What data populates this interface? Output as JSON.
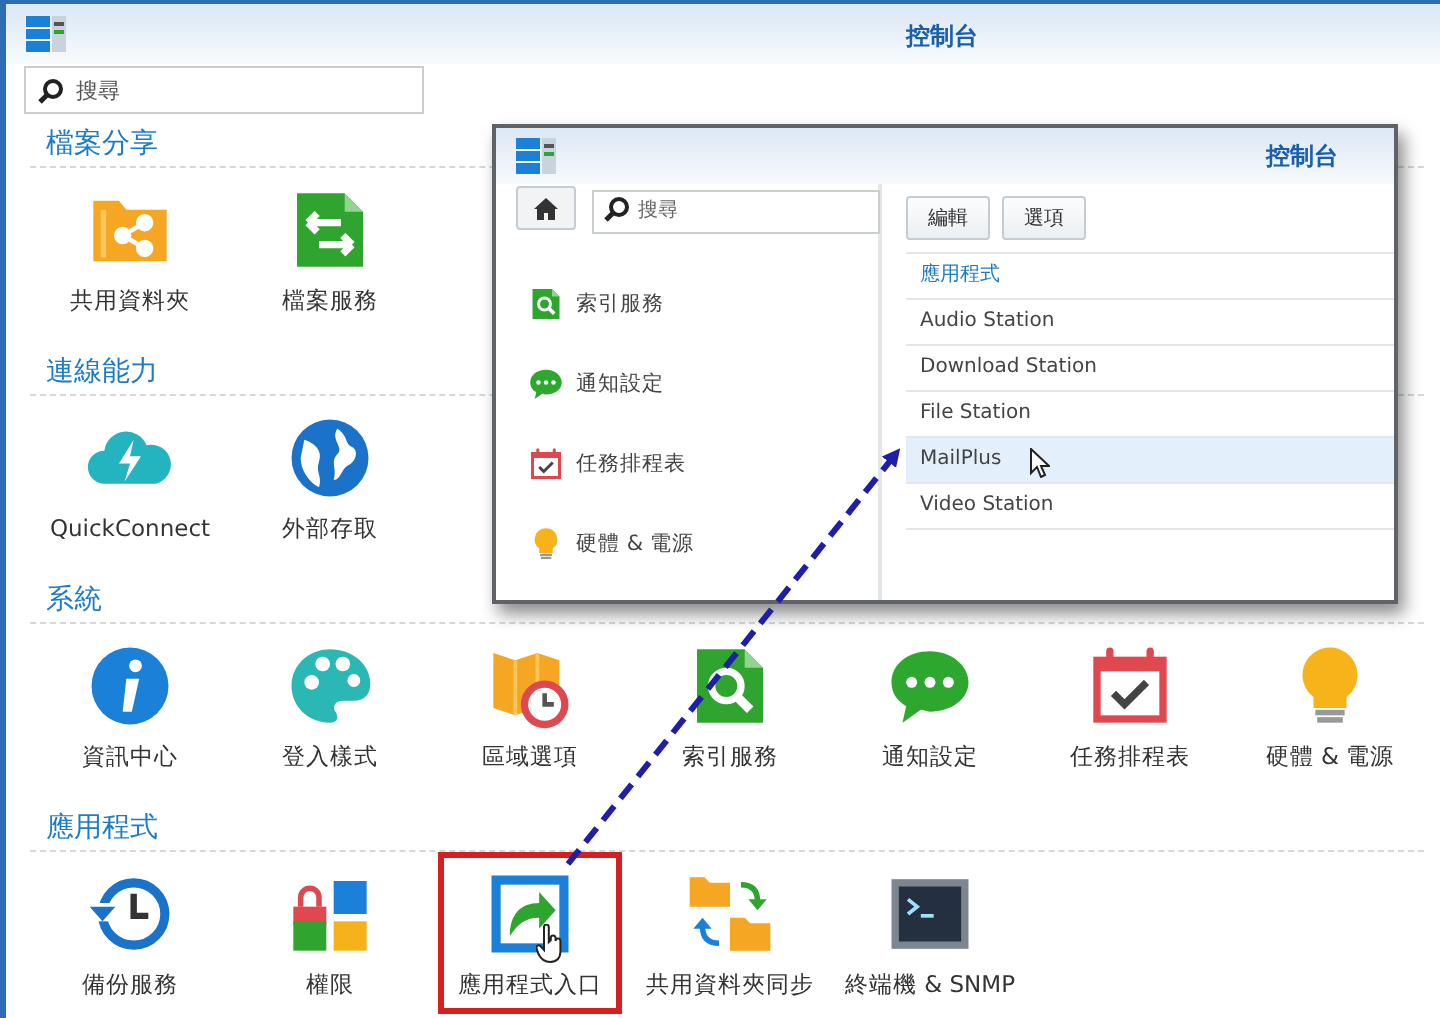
{
  "window": {
    "title": "控制台"
  },
  "search": {
    "placeholder": "搜尋"
  },
  "sections": [
    {
      "title": "檔案分享",
      "items": [
        {
          "label": "共用資料夾",
          "kind": "shared-folder",
          "highlighted": false
        },
        {
          "label": "檔案服務",
          "kind": "file-services",
          "highlighted": false
        }
      ]
    },
    {
      "title": "連線能力",
      "items": [
        {
          "label": "QuickConnect",
          "kind": "cloud",
          "highlighted": false
        },
        {
          "label": "外部存取",
          "kind": "globe",
          "highlighted": false
        }
      ]
    },
    {
      "title": "系統",
      "items": [
        {
          "label": "資訊中心",
          "kind": "info",
          "highlighted": false
        },
        {
          "label": "登入樣式",
          "kind": "palette",
          "highlighted": false
        },
        {
          "label": "區域選項",
          "kind": "map-clock",
          "highlighted": false
        },
        {
          "label": "索引服務",
          "kind": "doc-search",
          "highlighted": false
        },
        {
          "label": "通知設定",
          "kind": "chat",
          "highlighted": false
        },
        {
          "label": "任務排程表",
          "kind": "calendar",
          "highlighted": false
        },
        {
          "label": "硬體 & 電源",
          "kind": "bulb",
          "highlighted": false
        }
      ]
    },
    {
      "title": "應用程式",
      "items": [
        {
          "label": "備份服務",
          "kind": "backup",
          "highlighted": false
        },
        {
          "label": "權限",
          "kind": "tiles-lock",
          "highlighted": false
        },
        {
          "label": "應用程式入口",
          "kind": "portal",
          "highlighted": true
        },
        {
          "label": "共用資料夾同步",
          "kind": "folder-sync",
          "highlighted": false
        },
        {
          "label": "終端機 & SNMP",
          "kind": "terminal",
          "highlighted": false
        }
      ]
    }
  ],
  "inset": {
    "title": "控制台",
    "search": {
      "placeholder": "搜尋"
    },
    "buttons": [
      "編輯",
      "選項"
    ],
    "sidebar": [
      {
        "label": "索引服務",
        "kind": "doc-search"
      },
      {
        "label": "通知設定",
        "kind": "chat"
      },
      {
        "label": "任務排程表",
        "kind": "calendar"
      },
      {
        "label": "硬體 & 電源",
        "kind": "bulb"
      }
    ],
    "list": {
      "heading": "應用程式",
      "items": [
        {
          "label": "Audio Station",
          "selected": false
        },
        {
          "label": "Download Station",
          "selected": false
        },
        {
          "label": "File Station",
          "selected": false
        },
        {
          "label": "MailPlus",
          "selected": true
        },
        {
          "label": "Video Station",
          "selected": false
        }
      ]
    }
  }
}
